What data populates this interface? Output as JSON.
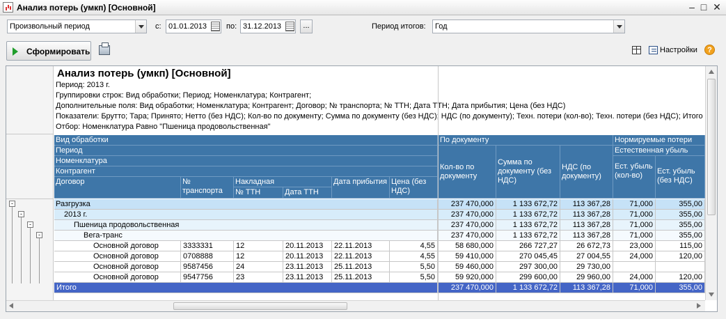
{
  "window": {
    "title": "Анализ потерь (умкп) [Основной]"
  },
  "toolbar": {
    "period_type": "Произвольный период",
    "from_label": "с:",
    "from_date": "01.01.2013",
    "to_label": "по:",
    "to_date": "31.12.2013",
    "dots_label": "...",
    "totals_period_label": "Период итогов:",
    "totals_period_value": "Год",
    "generate_label": "Сформировать",
    "settings_label": "Настройки",
    "help_label": "?"
  },
  "report_header": {
    "title": "Анализ потерь (умкп) [Основной]",
    "lines": [
      "Период: 2013 г.",
      "Группировки строк: Вид обработки; Период; Номенклатура; Контрагент;",
      "Дополнительные поля: Вид обработки; Номенклатура; Контрагент; Договор; № транспорта; №  ТТН; Дата ТТН; Дата прибытия; Цена (без НДС)",
      "Показатели: Брутто; Тара; Принято; Нетто  (без НДС); Кол-во по документу; Сумма по документу (без НДС); НДС (по документу); Техн. потери (кол-во); Техн. потери (без НДС); Итого потери (кол-во); Потери",
      "Отбор: Номенклатура Равно \"Пшеница продовольственная\""
    ]
  },
  "table_header": {
    "vid": "Вид обработки",
    "period": "Период",
    "nomen": "Номенклатура",
    "kontr": "Контрагент",
    "dogovor": "Договор",
    "transport": "№ транспорта",
    "nakladnaya": "Накладная",
    "ttn": "№  ТТН",
    "date_ttn": "Дата ТТН",
    "arrival": "Дата прибытия",
    "price": "Цена (без НДС)",
    "by_doc": "По документу",
    "qty_doc": "Кол-во по документу",
    "sum_doc": "Сумма по документу (без НДС)",
    "vat_doc": "НДС (по документу)",
    "norm_loss": "Нормируемые потери",
    "natural_loss": "Естественная убыль",
    "nat_qty": "Ест. убыль (кол-во)",
    "nat_sum": "Ест. убыль (без НДС)"
  },
  "groups": [
    {
      "label": "Разгрузка",
      "qty": "237 470,000",
      "sum": "1 133 672,72",
      "vat": "113 367,28",
      "nat_qty": "71,000",
      "nat_sum": "355,00"
    },
    {
      "label": "2013 г.",
      "qty": "237 470,000",
      "sum": "1 133 672,72",
      "vat": "113 367,28",
      "nat_qty": "71,000",
      "nat_sum": "355,00"
    },
    {
      "label": "Пшеница продовольственная",
      "qty": "237 470,000",
      "sum": "1 133 672,72",
      "vat": "113 367,28",
      "nat_qty": "71,000",
      "nat_sum": "355,00"
    },
    {
      "label": "Вега-транс",
      "qty": "237 470,000",
      "sum": "1 133 672,72",
      "vat": "113 367,28",
      "nat_qty": "71,000",
      "nat_sum": "355,00"
    }
  ],
  "rows": [
    {
      "dogovor": "Основной договор",
      "transport": "3333331",
      "ttn": "12",
      "date_ttn": "20.11.2013",
      "arrival": "22.11.2013",
      "price": "4,55",
      "qty": "58 680,000",
      "sum": "266 727,27",
      "vat": "26 672,73",
      "nat_qty": "23,000",
      "nat_sum": "115,00"
    },
    {
      "dogovor": "Основной договор",
      "transport": "0708888",
      "ttn": "12",
      "date_ttn": "20.11.2013",
      "arrival": "22.11.2013",
      "price": "4,55",
      "qty": "59 410,000",
      "sum": "270 045,45",
      "vat": "27 004,55",
      "nat_qty": "24,000",
      "nat_sum": "120,00"
    },
    {
      "dogovor": "Основной договор",
      "transport": "9587456",
      "ttn": "24",
      "date_ttn": "23.11.2013",
      "arrival": "25.11.2013",
      "price": "5,50",
      "qty": "59 460,000",
      "sum": "297 300,00",
      "vat": "29 730,00",
      "nat_qty": "",
      "nat_sum": ""
    },
    {
      "dogovor": "Основной договор",
      "transport": "9547756",
      "ttn": "23",
      "date_ttn": "23.11.2013",
      "arrival": "25.11.2013",
      "price": "5,50",
      "qty": "59 920,000",
      "sum": "299 600,00",
      "vat": "29 960,00",
      "nat_qty": "24,000",
      "nat_sum": "120,00"
    }
  ],
  "total": {
    "label": "Итого",
    "qty": "237 470,000",
    "sum": "1 133 672,72",
    "vat": "113 367,28",
    "nat_qty": "71,000",
    "nat_sum": "355,00"
  },
  "colors": {
    "header_blue": "#3e76a8",
    "group1": "#c6e2f7",
    "group2": "#d7ecfa",
    "group3": "#e8f4fc",
    "total_bar": "#4465c6"
  }
}
